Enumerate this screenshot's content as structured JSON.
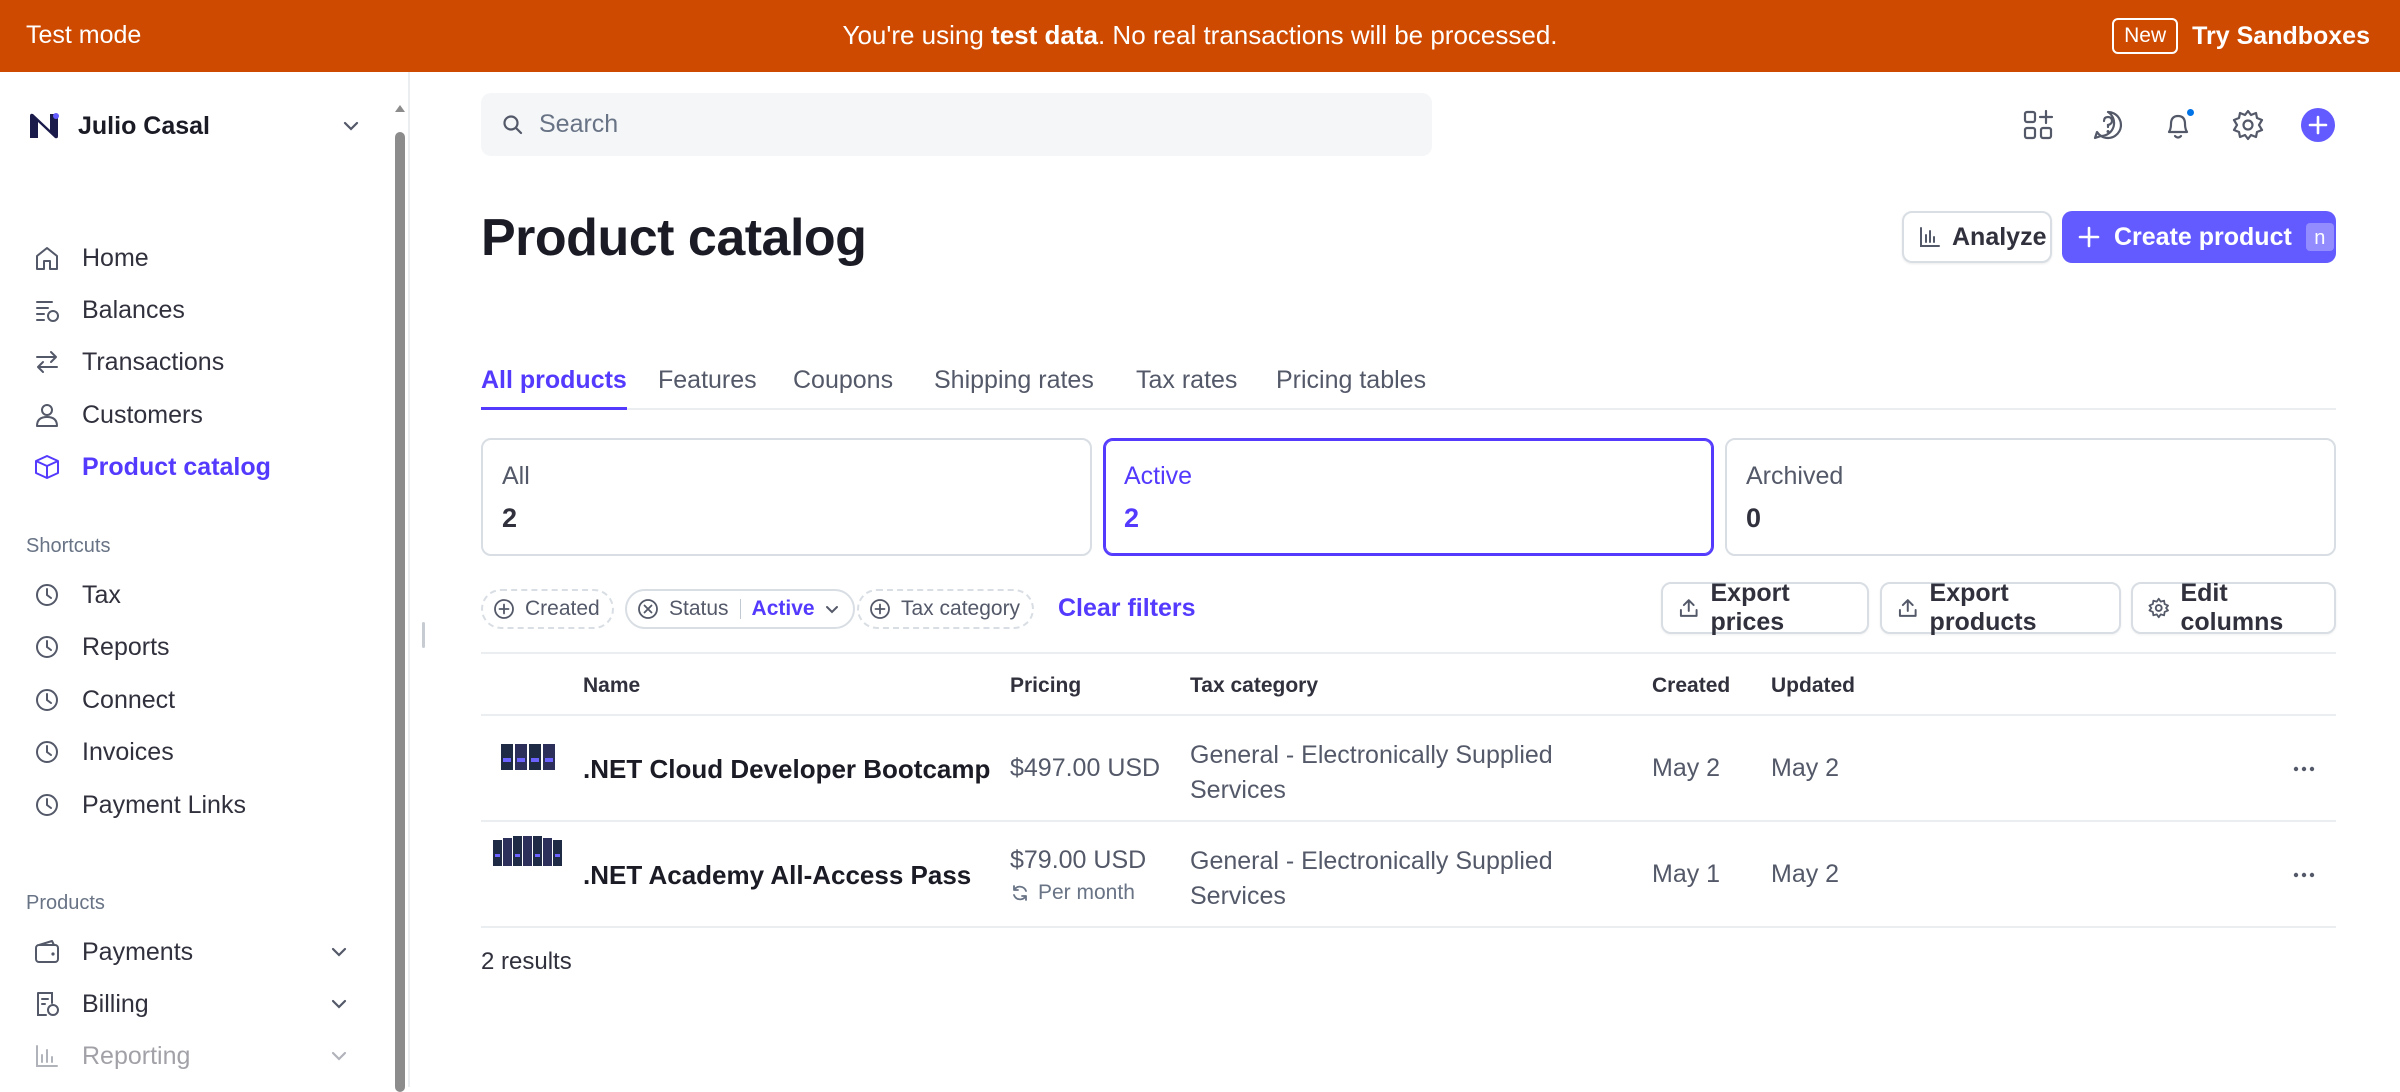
{
  "banner": {
    "left": "Test mode",
    "message_pre": "You're using ",
    "message_bold": "test data",
    "message_post": ". No real transactions will be processed.",
    "new_badge": "New",
    "try_link": "Try Sandboxes",
    "color": "#cd4a00"
  },
  "account": {
    "name": "Julio Casal"
  },
  "nav": {
    "items": [
      {
        "label": "Home",
        "icon": "home-icon"
      },
      {
        "label": "Balances",
        "icon": "balances-icon"
      },
      {
        "label": "Transactions",
        "icon": "transactions-icon"
      },
      {
        "label": "Customers",
        "icon": "customers-icon"
      },
      {
        "label": "Product catalog",
        "icon": "product-catalog-icon",
        "active": true
      }
    ],
    "shortcuts_label": "Shortcuts",
    "shortcuts": [
      "Tax",
      "Reports",
      "Connect",
      "Invoices",
      "Payment Links"
    ],
    "products_label": "Products",
    "products": [
      "Payments",
      "Billing",
      "Reporting"
    ]
  },
  "search": {
    "placeholder": "Search"
  },
  "page": {
    "title": "Product catalog",
    "analyze_label": "Analyze",
    "create_label": "Create product",
    "create_shortcut": "n",
    "accent": "#533afd"
  },
  "tabs": [
    "All products",
    "Features",
    "Coupons",
    "Shipping rates",
    "Tax rates",
    "Pricing tables"
  ],
  "status_cards": [
    {
      "label": "All",
      "count": "2"
    },
    {
      "label": "Active",
      "count": "2",
      "selected": true
    },
    {
      "label": "Archived",
      "count": "0"
    }
  ],
  "filters": {
    "created": "Created",
    "status": "Status",
    "status_value": "Active",
    "tax_category": "Tax category",
    "clear": "Clear filters"
  },
  "actions": {
    "export_prices": "Export prices",
    "export_products": "Export products",
    "edit_columns": "Edit columns"
  },
  "table": {
    "columns": [
      "Name",
      "Pricing",
      "Tax category",
      "Created",
      "Updated"
    ],
    "rows": [
      {
        "name": ".NET Cloud Developer Bootcamp",
        "price": "$497.00 USD",
        "recurring": "",
        "tax_line1": "General - Electronically Supplied",
        "tax_line2": "Services",
        "created": "May 2",
        "updated": "May 2"
      },
      {
        "name": ".NET Academy All-Access Pass",
        "price": "$79.00 USD",
        "recurring": "Per month",
        "tax_line1": "General - Electronically Supplied",
        "tax_line2": "Services",
        "created": "May 1",
        "updated": "May 2"
      }
    ],
    "results": "2 results"
  }
}
